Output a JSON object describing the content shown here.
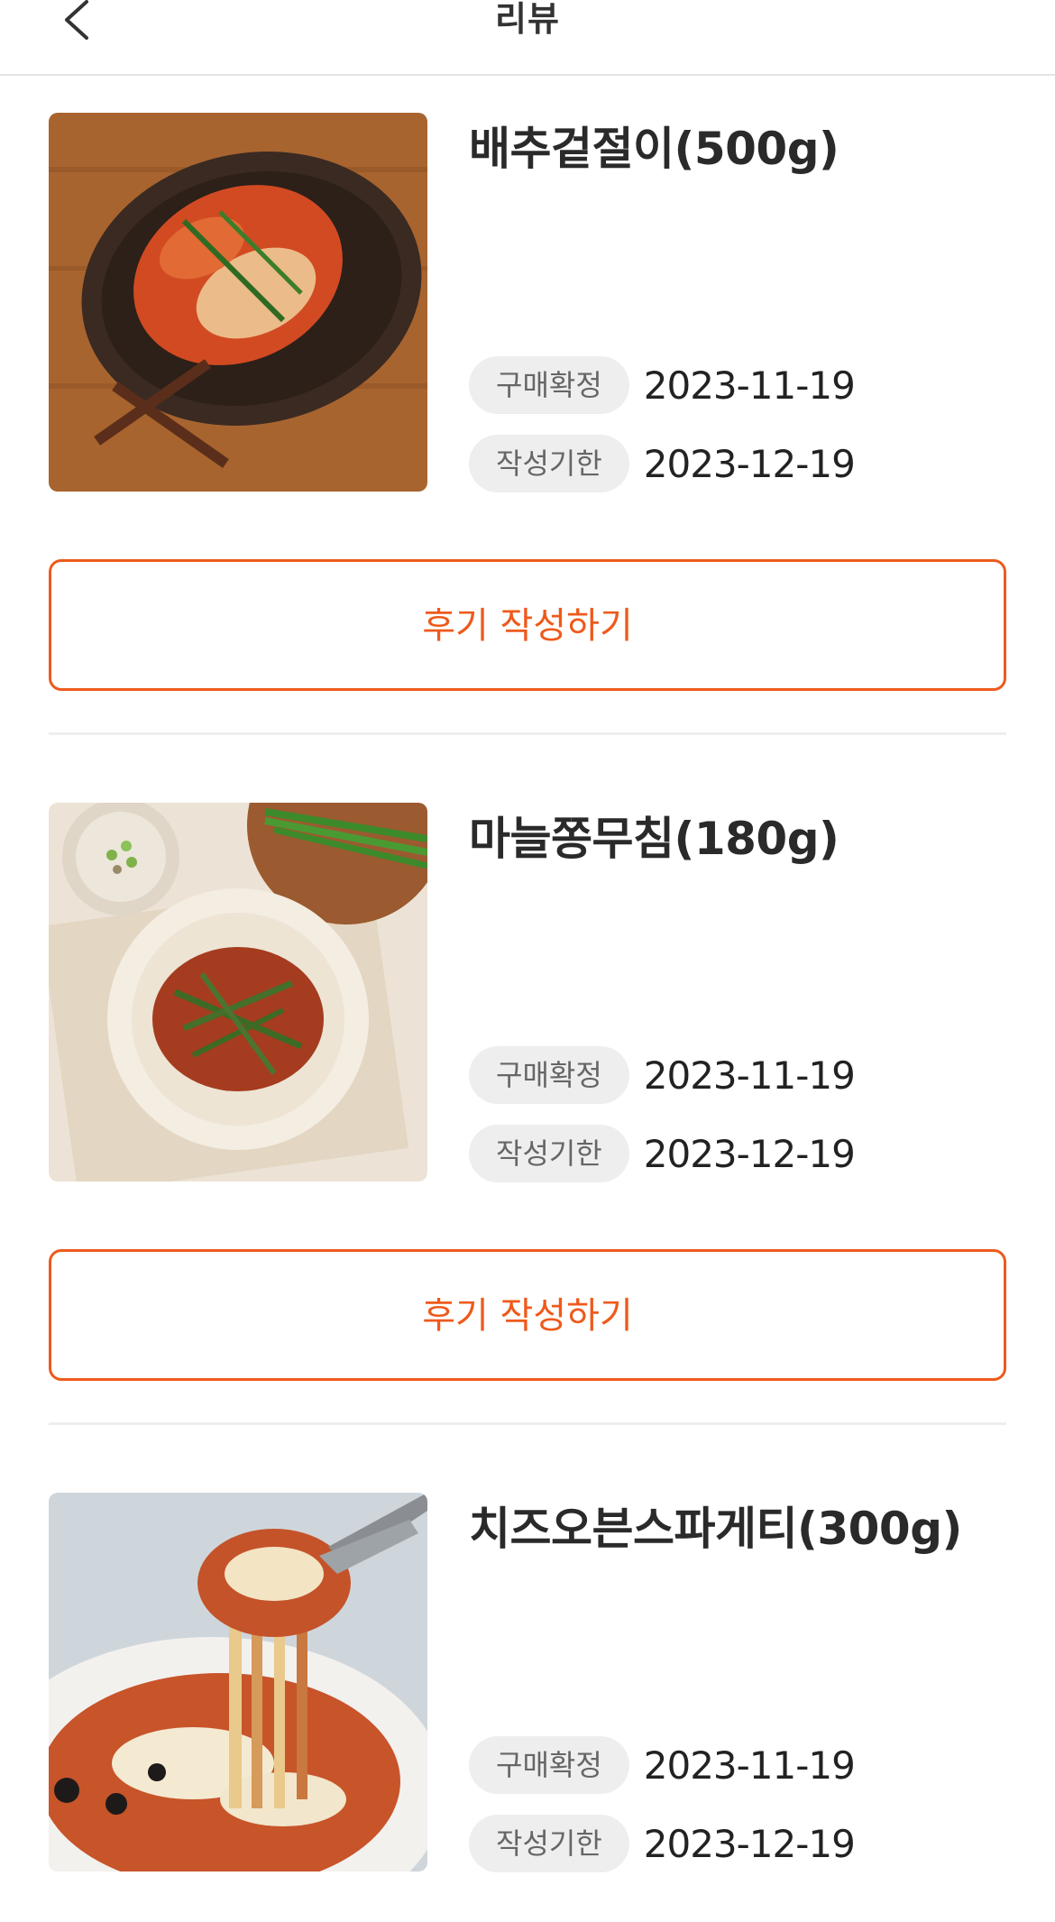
{
  "header": {
    "title": "리뷰",
    "back_icon": "chevron-left-icon"
  },
  "accent_color": "#ee5a1c",
  "items": [
    {
      "name": "배추겉절이(500g)",
      "purchase_label": "구매확정",
      "purchase_date": "2023-11-19",
      "deadline_label": "작성기한",
      "deadline_date": "2023-12-19",
      "button_label": "후기 작성하기"
    },
    {
      "name": "마늘쫑무침(180g)",
      "purchase_label": "구매확정",
      "purchase_date": "2023-11-19",
      "deadline_label": "작성기한",
      "deadline_date": "2023-12-19",
      "button_label": "후기 작성하기"
    },
    {
      "name": "치즈오븐스파게티(300g)",
      "purchase_label": "구매확정",
      "purchase_date": "2023-11-19",
      "deadline_label": "작성기한",
      "deadline_date": "2023-12-19"
    }
  ]
}
